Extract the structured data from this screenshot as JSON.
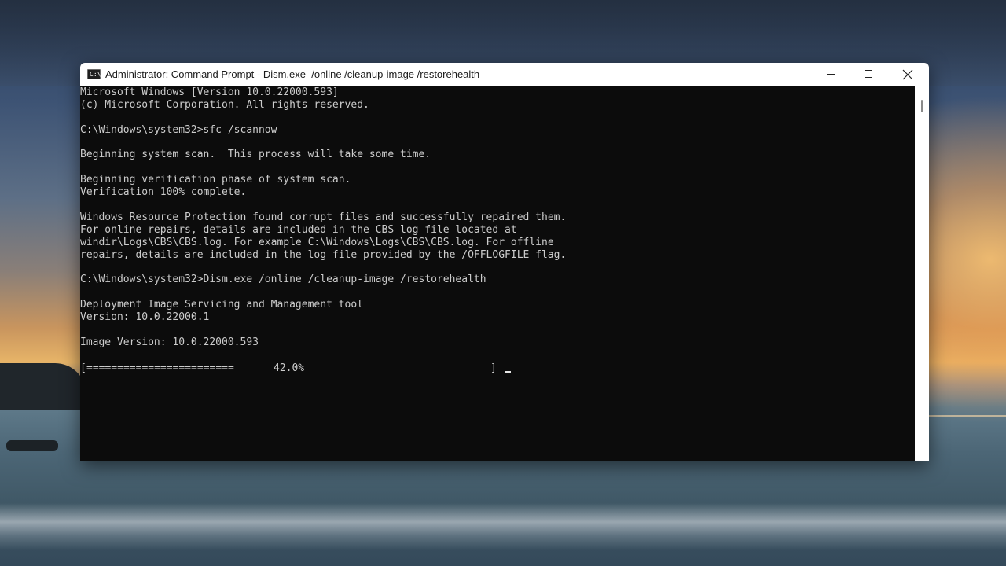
{
  "window": {
    "title": "Administrator: Command Prompt - Dism.exe  /online /cleanup-image /restorehealth",
    "app_icon": "C:\\",
    "icons": {
      "app": "console-app-icon",
      "minimize": "minimize-icon",
      "maximize": "maximize-icon",
      "close": "close-icon"
    }
  },
  "console": {
    "lines": [
      "Microsoft Windows [Version 10.0.22000.593]",
      "(c) Microsoft Corporation. All rights reserved.",
      "",
      "C:\\Windows\\system32>sfc /scannow",
      "",
      "Beginning system scan.  This process will take some time.",
      "",
      "Beginning verification phase of system scan.",
      "Verification 100% complete.",
      "",
      "Windows Resource Protection found corrupt files and successfully repaired them.",
      "For online repairs, details are included in the CBS log file located at",
      "windir\\Logs\\CBS\\CBS.log. For example C:\\Windows\\Logs\\CBS\\CBS.log. For offline",
      "repairs, details are included in the log file provided by the /OFFLOGFILE flag.",
      "",
      "C:\\Windows\\system32>Dism.exe /online /cleanup-image /restorehealth",
      "",
      "Deployment Image Servicing and Management tool",
      "Version: 10.0.22000.1",
      "",
      "Image Version: 10.0.22000.593",
      ""
    ],
    "progress": {
      "open": "[",
      "fill": "========================",
      "percent_text": "42.0%",
      "close": "]",
      "value": 0.42
    }
  },
  "colors": {
    "console_bg": "#0c0c0c",
    "console_text": "#cccccc",
    "titlebar_bg": "#ffffff"
  }
}
